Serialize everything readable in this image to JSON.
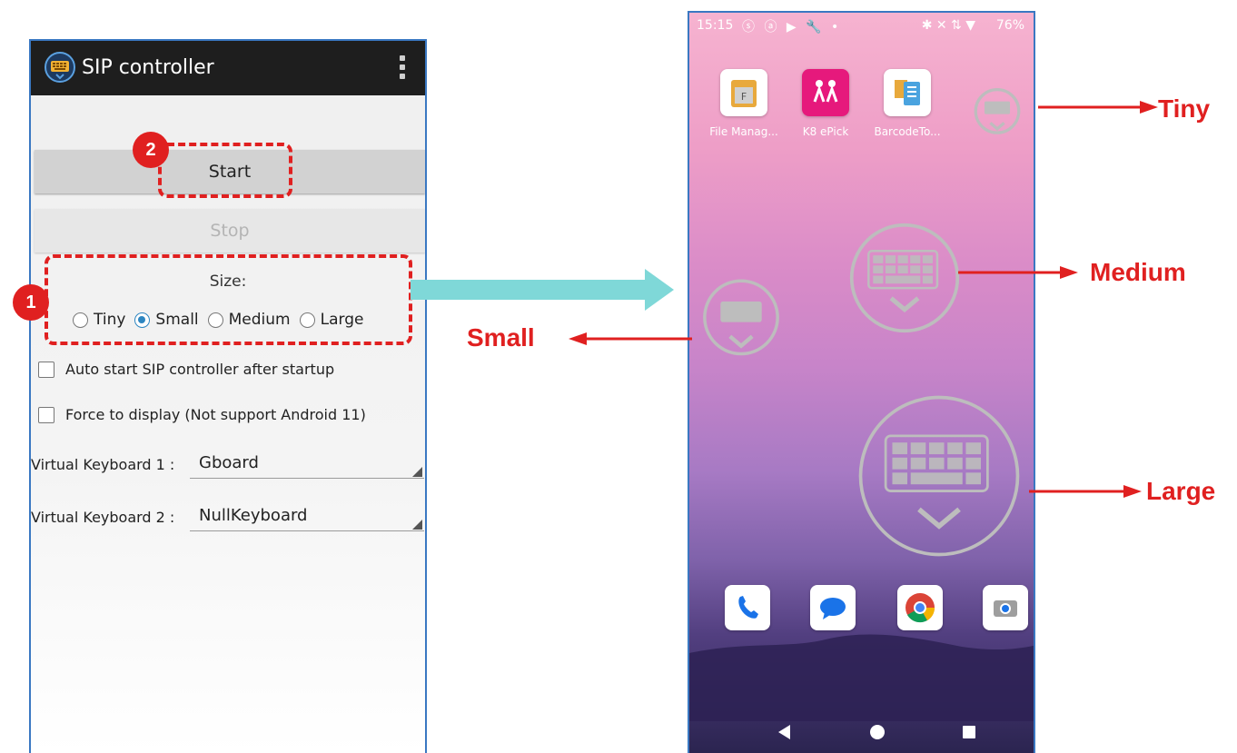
{
  "left_app": {
    "title": "SIP controller",
    "start_label": "Start",
    "stop_label": "Stop",
    "size_label": "Size:",
    "size_options": [
      "Tiny",
      "Small",
      "Medium",
      "Large"
    ],
    "size_selected": "Small",
    "checkbox_autostart": "Auto start SIP controller after startup",
    "checkbox_force": "Force to display (Not support Android 11)",
    "keyboard1_label": "Virtual Keyboard 1 :",
    "keyboard1_value": "Gboard",
    "keyboard2_label": "Virtual Keyboard 2 :",
    "keyboard2_value": "NullKeyboard"
  },
  "callouts": {
    "step1": "1",
    "step2": "2"
  },
  "home": {
    "time": "15:15",
    "status_icons": "ⓢ ⓐ ▶ 🔧 •",
    "status_right": "✱ ✕ ⇅ ▼",
    "battery": "76%",
    "apps": [
      {
        "name": "File Manag...",
        "icon": "file-manager-icon"
      },
      {
        "name": "K8 ePick",
        "icon": "epick-icon"
      },
      {
        "name": "BarcodeTo...",
        "icon": "barcode-to-icon"
      }
    ],
    "dock": [
      "phone-icon",
      "messages-icon",
      "chrome-icon",
      "camera-icon"
    ]
  },
  "size_labels": {
    "tiny": "Tiny",
    "small": "Small",
    "medium": "Medium",
    "large": "Large"
  },
  "colors": {
    "callout_red": "#e02020",
    "arrow_cyan": "#7fd8d8",
    "radio_blue": "#2e86c1"
  }
}
